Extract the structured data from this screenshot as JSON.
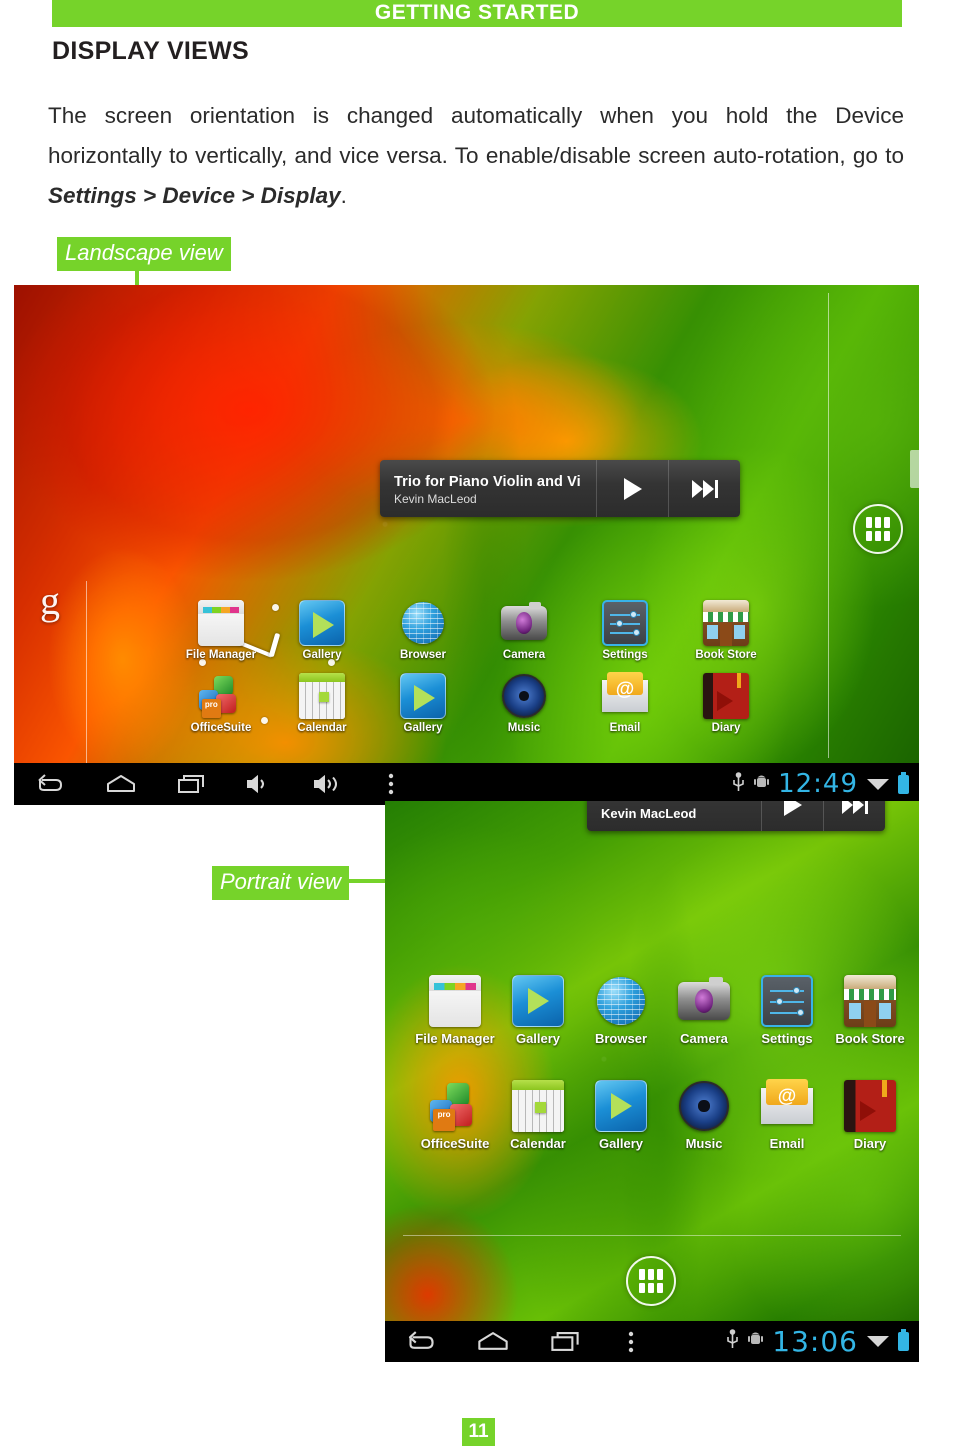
{
  "document": {
    "chapter_header": "GETTING STARTED",
    "section_title": "DISPLAY VIEWS",
    "body_part1": "The screen orientation is changed automatically when you hold the Device horizontally to vertically, and vice versa. To enable/disable screen auto-rotation, go to ",
    "body_emphasis": "Settings > Device > Display",
    "body_part2": ".",
    "page_number": "11"
  },
  "callouts": {
    "landscape": "Landscape view",
    "portrait": "Portrait view"
  },
  "colors": {
    "accent_green": "#76D32A",
    "clock_cyan": "#33b5e5",
    "label_white": "#ffffff"
  },
  "landscape_screen": {
    "search_widget": {
      "logo": "google-g-logo"
    },
    "clock_widget": {
      "name": "analog-clock-widget"
    },
    "music_widget": {
      "title": "Trio for Piano Violin and Vi",
      "artist": "Kevin MacLeod",
      "play_icon": "play-icon",
      "next_icon": "next-track-icon"
    },
    "apps_row1": [
      {
        "label": "File Manager",
        "icon": "file-manager-icon"
      },
      {
        "label": "Gallery",
        "icon": "gallery-icon"
      },
      {
        "label": "Browser",
        "icon": "browser-icon"
      },
      {
        "label": "Camera",
        "icon": "camera-icon"
      },
      {
        "label": "Settings",
        "icon": "settings-icon"
      },
      {
        "label": "Book Store",
        "icon": "book-store-icon"
      }
    ],
    "apps_row2": [
      {
        "label": "OfficeSuite",
        "icon": "officesuite-icon",
        "badge": "pro"
      },
      {
        "label": "Calendar",
        "icon": "calendar-icon"
      },
      {
        "label": "Gallery",
        "icon": "gallery-icon"
      },
      {
        "label": "Music",
        "icon": "music-icon"
      },
      {
        "label": "Email",
        "icon": "email-icon"
      },
      {
        "label": "Diary",
        "icon": "diary-icon"
      }
    ],
    "drawer_button": "app-drawer-button",
    "system_bar": {
      "back": "back-icon",
      "home": "home-icon",
      "recents": "recent-apps-icon",
      "volume_down": "volume-down-icon",
      "volume_up": "volume-up-icon",
      "menu": "overflow-menu-icon",
      "usb": "usb-icon",
      "debug": "android-debug-icon",
      "clock": "12:49",
      "wifi": "wifi-icon",
      "battery": "battery-charging-icon"
    }
  },
  "portrait_screen": {
    "music_widget": {
      "artist": "Kevin MacLeod",
      "play_icon": "play-icon",
      "next_icon": "next-track-icon"
    },
    "apps_row1": [
      {
        "label": "File Manager",
        "icon": "file-manager-icon"
      },
      {
        "label": "Gallery",
        "icon": "gallery-icon"
      },
      {
        "label": "Browser",
        "icon": "browser-icon"
      },
      {
        "label": "Camera",
        "icon": "camera-icon"
      },
      {
        "label": "Settings",
        "icon": "settings-icon"
      },
      {
        "label": "Book Store",
        "icon": "book-store-icon"
      }
    ],
    "apps_row2": [
      {
        "label": "OfficeSuite",
        "icon": "officesuite-icon",
        "badge": "pro"
      },
      {
        "label": "Calendar",
        "icon": "calendar-icon"
      },
      {
        "label": "Gallery",
        "icon": "gallery-icon"
      },
      {
        "label": "Music",
        "icon": "music-icon"
      },
      {
        "label": "Email",
        "icon": "email-icon"
      },
      {
        "label": "Diary",
        "icon": "diary-icon"
      }
    ],
    "drawer_button": "app-drawer-button",
    "system_bar": {
      "back": "back-icon",
      "home": "home-icon",
      "recents": "recent-apps-icon",
      "menu": "overflow-menu-icon",
      "usb": "usb-icon",
      "debug": "android-debug-icon",
      "clock": "13:06",
      "wifi": "wifi-icon",
      "battery": "battery-charging-icon"
    }
  }
}
